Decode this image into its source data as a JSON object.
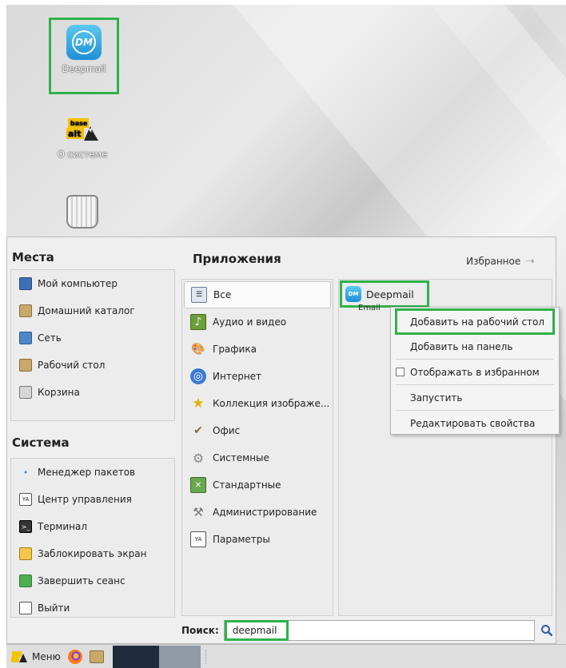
{
  "desktop": {
    "icons": [
      {
        "label": "Deepmail",
        "logo_text": "DM"
      },
      {
        "label": "О системе",
        "logo_text": "base alt"
      },
      {
        "label": ""
      }
    ]
  },
  "menu": {
    "places_title": "Места",
    "places": [
      {
        "label": "Мой компьютер",
        "icon": "computer-icon"
      },
      {
        "label": "Домашний каталог",
        "icon": "home-folder-icon"
      },
      {
        "label": "Сеть",
        "icon": "network-icon"
      },
      {
        "label": "Рабочий стол",
        "icon": "desktop-folder-icon"
      },
      {
        "label": "Корзина",
        "icon": "trash-icon"
      }
    ],
    "system_title": "Система",
    "system": [
      {
        "label": "Менеджер пакетов",
        "icon": "package-manager-icon"
      },
      {
        "label": "Центр управления",
        "icon": "control-center-icon"
      },
      {
        "label": "Терминал",
        "icon": "terminal-icon"
      },
      {
        "label": "Заблокировать экран",
        "icon": "lock-screen-icon"
      },
      {
        "label": "Завершить сеанс",
        "icon": "logout-icon"
      },
      {
        "label": "Выйти",
        "icon": "exit-icon"
      }
    ],
    "apps_title": "Приложения",
    "favorites_label": "Избранное",
    "categories": [
      {
        "label": "Все",
        "icon": "all-apps-icon"
      },
      {
        "label": "Аудио и видео",
        "icon": "audio-video-icon"
      },
      {
        "label": "Графика",
        "icon": "graphics-icon"
      },
      {
        "label": "Интернет",
        "icon": "internet-icon"
      },
      {
        "label": "Коллекция изображе...",
        "icon": "star-icon"
      },
      {
        "label": "Офис",
        "icon": "office-icon"
      },
      {
        "label": "Системные",
        "icon": "system-icon"
      },
      {
        "label": "Стандартные",
        "icon": "accessories-icon"
      },
      {
        "label": "Администрирование",
        "icon": "admin-tools-icon"
      },
      {
        "label": "Параметры",
        "icon": "settings-icon"
      }
    ],
    "app": {
      "name": "Deepmail",
      "subtitle": "Email"
    },
    "context_menu": [
      {
        "label": "Добавить на рабочий стол"
      },
      {
        "label": "Добавить на панель"
      },
      {
        "label": "Отображать в избранном"
      },
      {
        "label": "Запустить"
      },
      {
        "label": "Редактировать свойства"
      }
    ],
    "search": {
      "label": "Поиск:",
      "value": "deepmail"
    }
  },
  "taskbar": {
    "menu_label": "Меню"
  },
  "colors": {
    "highlight": "#2fb24a"
  }
}
